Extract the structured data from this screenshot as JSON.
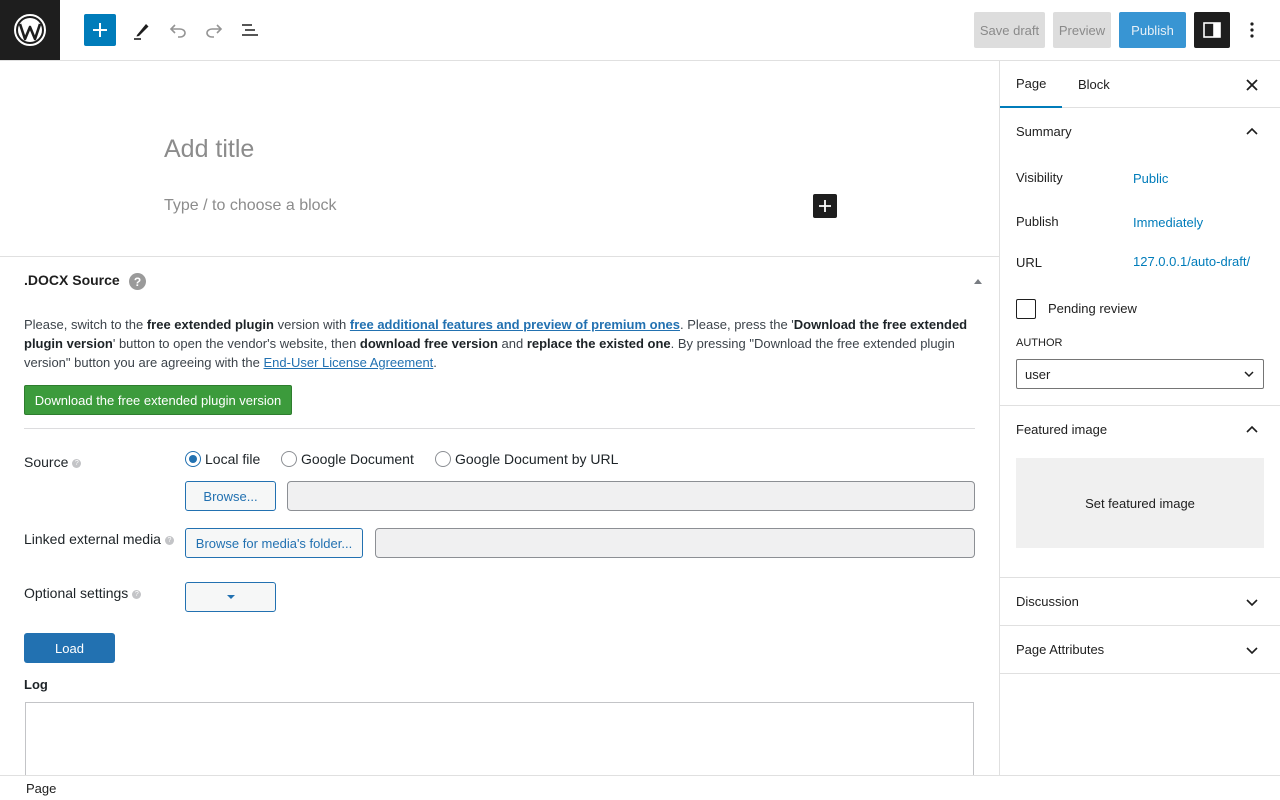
{
  "toolbar": {
    "save_draft": "Save draft",
    "preview": "Preview",
    "publish": "Publish",
    "icons": [
      "wordpress-logo-icon",
      "plus-icon",
      "pencil-icon",
      "undo-icon",
      "redo-icon",
      "list-view-icon",
      "sidebar-toggle-icon",
      "more-options-icon"
    ],
    "accent": "#007cba"
  },
  "editor": {
    "title_placeholder": "Add title",
    "block_placeholder": "Type / to choose a block"
  },
  "docx": {
    "title": ".DOCX Source",
    "help": "?",
    "notice": {
      "p1": "Please, switch to the ",
      "b1": "free extended plugin",
      "p2": " version with ",
      "link1": "free additional features and preview of premium ones",
      "p3": ". Please, press the '",
      "b2": "Download the free extended plugin version",
      "p4": "' button to open the vendor's website, then ",
      "b3": "download free version",
      "p5": " and ",
      "b4": "replace the existed one",
      "p6": ". By pressing \"Download the free extended plugin version\" button you are agreeing with the ",
      "link2": "End-User License Agreement",
      "p7": "."
    },
    "download_button": "Download the free extended plugin version",
    "source_label": "Source",
    "source_options": [
      "Local file",
      "Google Document",
      "Google Document by URL"
    ],
    "source_selected": "Local file",
    "browse_button": "Browse...",
    "linked_media_label": "Linked external media",
    "browse_media_button": "Browse for media's folder...",
    "optional_settings_label": "Optional settings",
    "load_button": "Load",
    "log_label": "Log",
    "help_small": "?"
  },
  "footer": {
    "breadcrumb": "Page"
  },
  "sidebar": {
    "tabs": [
      "Page",
      "Block"
    ],
    "summary": {
      "title": "Summary",
      "visibility_label": "Visibility",
      "visibility_value": "Public",
      "publish_label": "Publish",
      "publish_value": "Immediately",
      "url_label": "URL",
      "url_value": "127.0.0.1/auto-draft/",
      "pending_label": "Pending review",
      "author_label": "AUTHOR",
      "author_value": "user"
    },
    "featured_image": {
      "title": "Featured image",
      "set_label": "Set featured image"
    },
    "discussion": "Discussion",
    "page_attributes": "Page Attributes"
  }
}
